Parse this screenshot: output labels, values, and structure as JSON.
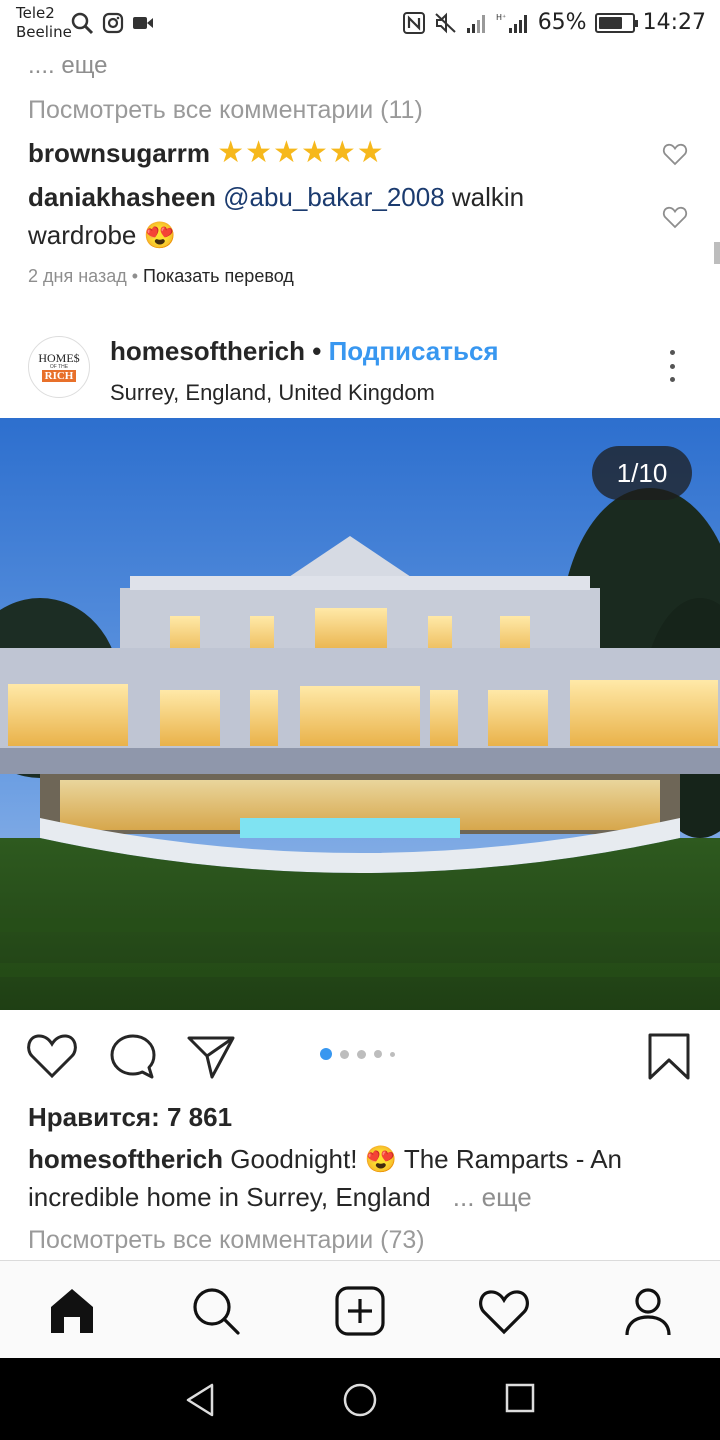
{
  "status_bar": {
    "carrier1": "Tele2",
    "carrier2": "Beeline",
    "battery_text": "65%",
    "battery_level": 0.65,
    "time": "14:27"
  },
  "comments_section": {
    "more_label": ".... еще",
    "view_all_label": "Посмотреть все комментарии (11)",
    "comments": [
      {
        "user": "brownsugarrm",
        "text": "★★★★★★"
      },
      {
        "user": "daniakhasheen",
        "mention": "@abu_bakar_2008",
        "text": " walkin wardrobe 😍"
      }
    ],
    "time_ago": "2 дня назад",
    "separator": " • ",
    "translate_label": "Показать перевод"
  },
  "post": {
    "avatar_logo": {
      "line1": "HOME$",
      "line2": "OF THE",
      "line3": "RICH"
    },
    "username": "homesoftherich",
    "dot": " • ",
    "follow_label": "Подписаться",
    "location": "Surrey, England, United Kingdom",
    "photo_counter": "1/10",
    "carousel_total_dots": 5,
    "carousel_active_index": 0,
    "likes_label": "Нравится: 7 861",
    "caption_user": "homesoftherich",
    "caption_text": " Goodnight! 😍 The Ramparts - An incredible home in Surrey, England",
    "caption_more": "... еще",
    "view_all_comments": "Посмотреть все комментарии (73)"
  },
  "bottom_nav": {
    "items": [
      "home-icon",
      "search-icon",
      "add-post-icon",
      "activity-heart-icon",
      "profile-icon"
    ]
  },
  "system_nav": {
    "items": [
      "back-icon",
      "home-circle-icon",
      "recents-icon"
    ]
  },
  "colors": {
    "link_blue": "#3897f0",
    "mention_blue": "#1b3b6f",
    "muted_text": "#8e8e8e",
    "star_gold": "#f6b81c"
  }
}
